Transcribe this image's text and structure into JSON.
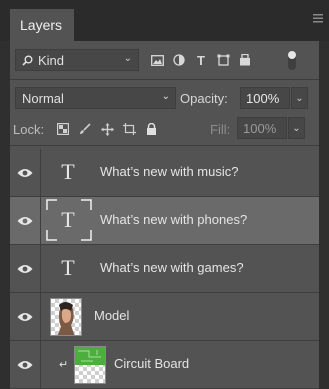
{
  "panel": {
    "tab_label": "Layers",
    "menu_icon": "panel-menu-icon"
  },
  "filter": {
    "kind_label": "Kind",
    "icons": [
      "image-filter-icon",
      "adjustment-filter-icon",
      "type-filter-icon",
      "shape-filter-icon",
      "smart-object-filter-icon"
    ],
    "type_glyph": "T"
  },
  "blend": {
    "mode": "Normal",
    "opacity_label": "Opacity:",
    "opacity_value": "100%"
  },
  "lock": {
    "label": "Lock:",
    "icons": [
      "lock-transparent-pixels-icon",
      "lock-image-pixels-icon",
      "lock-position-icon",
      "lock-artboard-icon",
      "lock-all-icon"
    ],
    "fill_label": "Fill:",
    "fill_value": "100%"
  },
  "layers": [
    {
      "name": "What’s new with music?",
      "kind": "text",
      "visible": true,
      "selected": false
    },
    {
      "name": "What’s new with phones?",
      "kind": "text",
      "visible": true,
      "selected": true
    },
    {
      "name": "What’s new with games?",
      "kind": "text",
      "visible": true,
      "selected": false
    },
    {
      "name": "Model",
      "kind": "image",
      "visible": true,
      "selected": false
    },
    {
      "name": "Circuit Board",
      "kind": "image",
      "visible": true,
      "selected": false,
      "clipped": true
    }
  ],
  "colors": {
    "panel_bg": "#535353",
    "selected_row": "#6a6a6a",
    "circuit_green": "#4cae3c"
  },
  "type_thumb_glyph": "T"
}
